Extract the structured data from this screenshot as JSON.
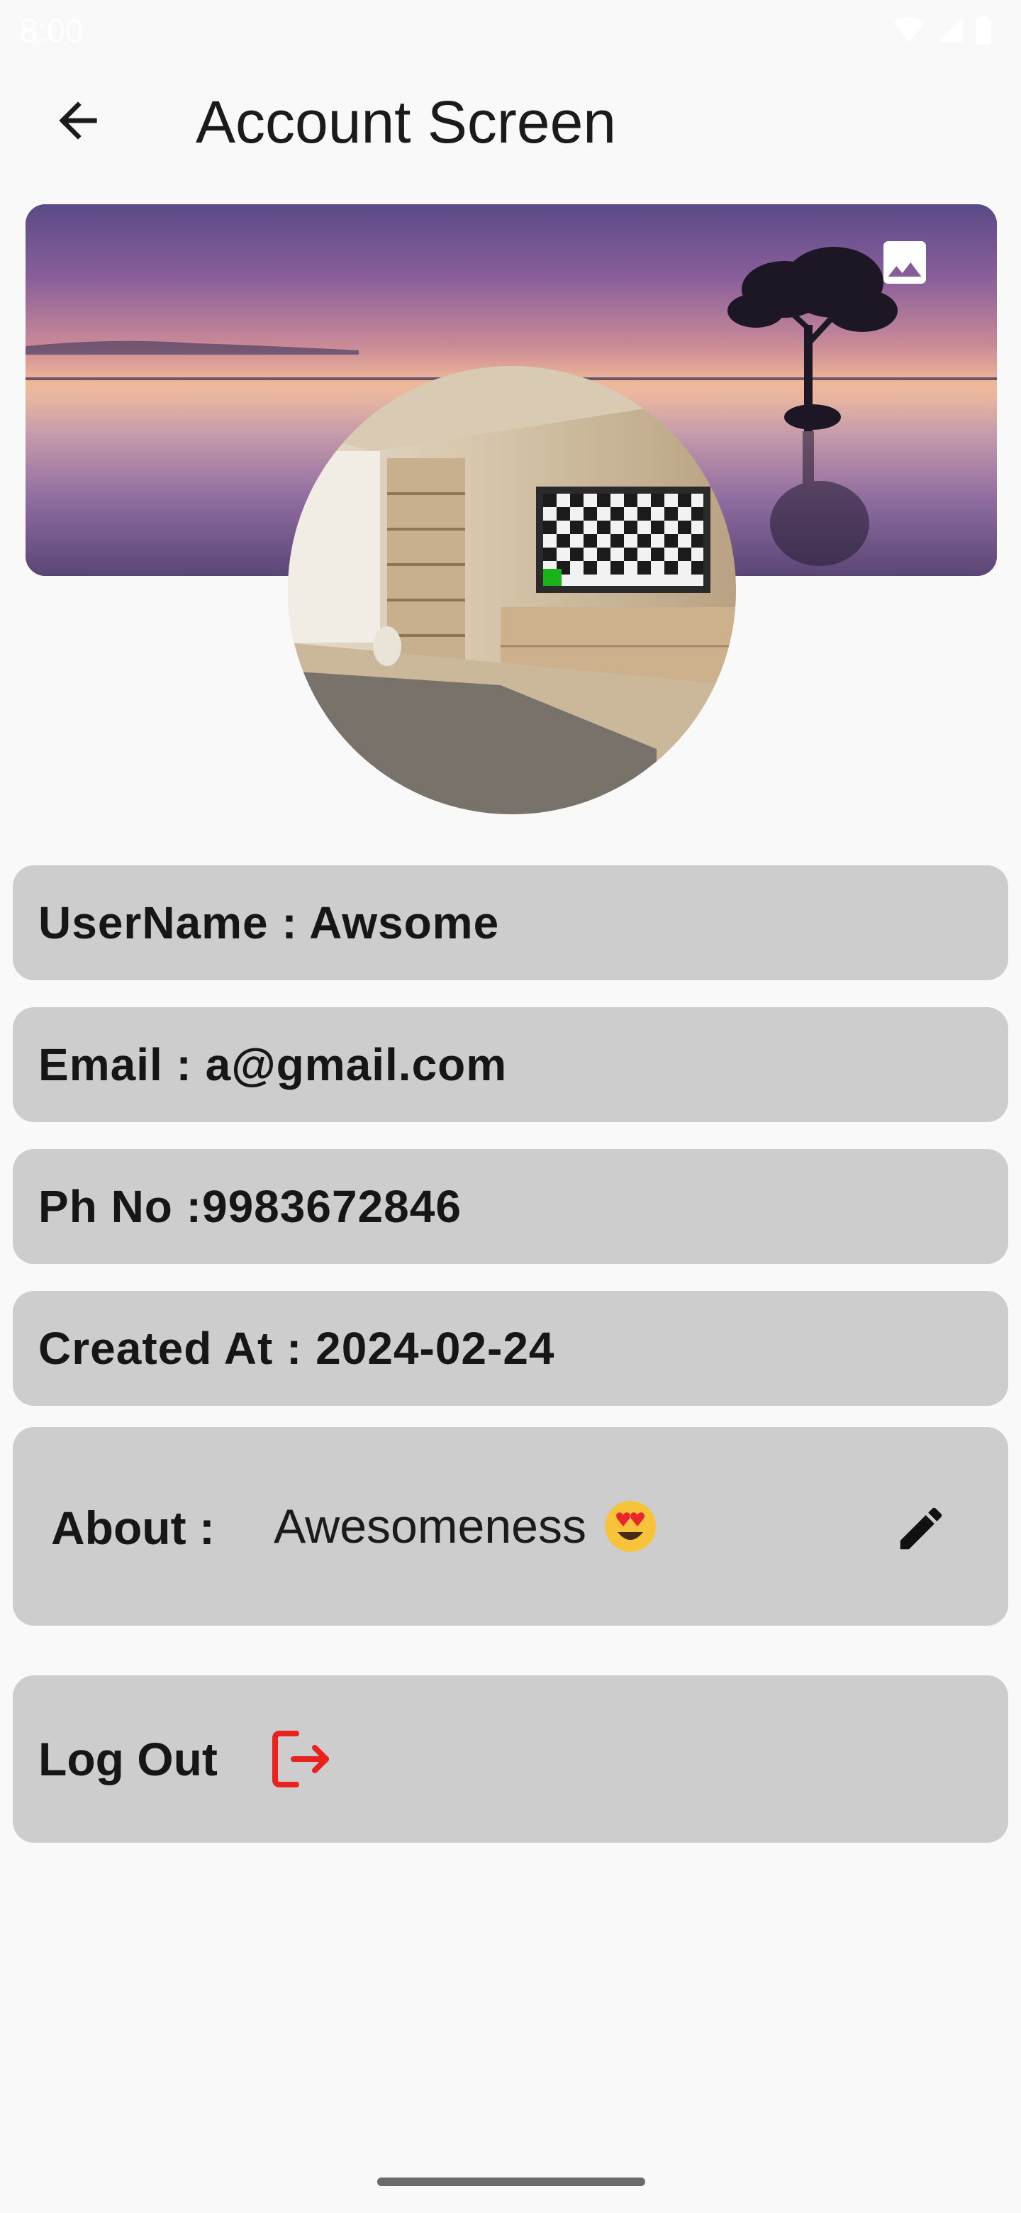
{
  "status_bar": {
    "time": "8:00",
    "icons": [
      "wifi-icon",
      "cellular-signal-icon",
      "battery-icon"
    ]
  },
  "app_bar": {
    "title": "Account Screen",
    "back_icon": "arrow-back-icon"
  },
  "cover": {
    "change_icon": "image-icon"
  },
  "profile": {
    "username": "UserName : Awsome",
    "email": "Email : a@gmail.com",
    "phone": "Ph No :9983672846",
    "created_at": "Created At : 2024-02-24"
  },
  "about": {
    "label": "About :",
    "value": "Awesomeness",
    "emoji_icon": "heart-eyes-emoji",
    "edit_icon": "pencil-edit-icon"
  },
  "logout": {
    "label": "Log Out",
    "icon": "logout-icon",
    "icon_color": "#e8231d"
  },
  "colors": {
    "background": "#f9f9f9",
    "card": "#cdcdcd",
    "text": "#161616"
  }
}
